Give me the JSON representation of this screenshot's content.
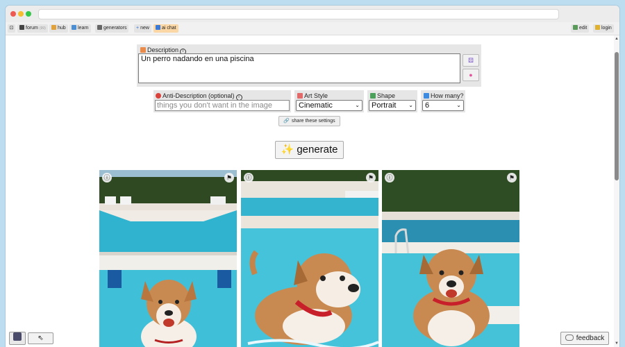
{
  "nav": {
    "items": [
      {
        "label": "forum",
        "count": "(99)"
      },
      {
        "label": "hub"
      },
      {
        "label": "learn"
      },
      {
        "label": "generators"
      },
      {
        "label": "new"
      },
      {
        "label": "ai chat"
      }
    ],
    "right": [
      {
        "label": "edit"
      },
      {
        "label": "login"
      }
    ]
  },
  "description": {
    "label": "Description",
    "value": "Un perro nadando en una piscina"
  },
  "anti_description": {
    "label": "Anti-Description (optional)",
    "placeholder": "things you don't want in the image"
  },
  "art_style": {
    "label": "Art Style",
    "selected": "Cinematic"
  },
  "shape": {
    "label": "Shape",
    "selected": "Portrait"
  },
  "how_many": {
    "label": "How many?",
    "selected": "6"
  },
  "share_label": "share these settings",
  "generate_label": "✨ generate",
  "images": [
    {
      "subject": "dog in pool on pool steps"
    },
    {
      "subject": "dog with red collar in pool"
    },
    {
      "subject": "dog with red collar near pool ladder"
    }
  ],
  "feedback_label": "feedback",
  "icons": {
    "info": "info-icon",
    "flag": "flag-icon",
    "share": "link-icon",
    "sparkles": "sparkles-icon"
  },
  "colors": {
    "page_bg": "#bcdcf0",
    "panel_bg": "#e6e6e6",
    "chat_tab": "#fbd7a6"
  }
}
